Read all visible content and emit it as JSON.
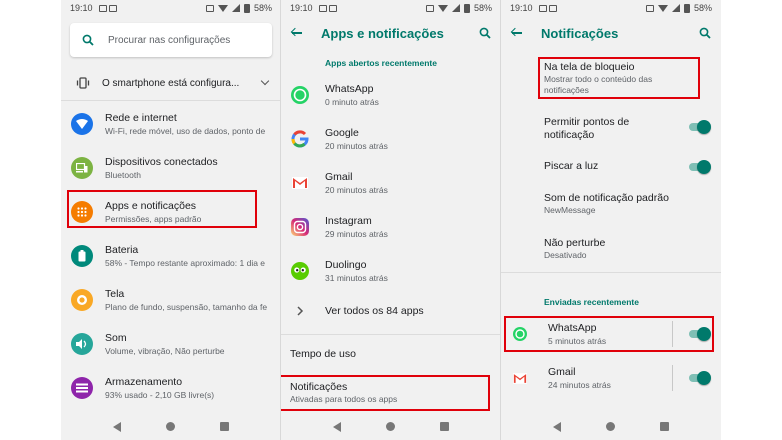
{
  "status": {
    "time": "19:10",
    "battery": "58%"
  },
  "screen1": {
    "search_placeholder": "Procurar nas configurações",
    "suggestion": "O smartphone está configura...",
    "items": [
      {
        "title": "Rede e internet",
        "subtitle": "Wi-Fi, rede móvel, uso de dados, ponto de",
        "color": "#1a73e8",
        "icon": "wifi-icon"
      },
      {
        "title": "Dispositivos conectados",
        "subtitle": "Bluetooth",
        "color": "#7cb342",
        "icon": "devices-icon"
      },
      {
        "title": "Apps e notificações",
        "subtitle": "Permissões, apps padrão",
        "color": "#f57c00",
        "icon": "apps-grid-icon"
      },
      {
        "title": "Bateria",
        "subtitle": "58% - Tempo restante aproximado: 1 dia e",
        "color": "#00897b",
        "icon": "battery-icon"
      },
      {
        "title": "Tela",
        "subtitle": "Plano de fundo, suspensão, tamanho da fe",
        "color": "#f9a825",
        "icon": "brightness-icon"
      },
      {
        "title": "Som",
        "subtitle": "Volume, vibração, Não perturbe",
        "color": "#26a69a",
        "icon": "volume-icon"
      },
      {
        "title": "Armazenamento",
        "subtitle": "93% usado - 2,10 GB livre(s)",
        "color": "#8e24aa",
        "icon": "storage-icon"
      }
    ]
  },
  "screen2": {
    "title": "Apps e notificações",
    "section": "Apps abertos recentemente",
    "apps": [
      {
        "name": "WhatsApp",
        "time": "0 minuto atrás",
        "icon": "whatsapp-icon"
      },
      {
        "name": "Google",
        "time": "20 minutos atrás",
        "icon": "google-icon"
      },
      {
        "name": "Gmail",
        "time": "20 minutos atrás",
        "icon": "gmail-icon"
      },
      {
        "name": "Instagram",
        "time": "29 minutos atrás",
        "icon": "instagram-icon"
      },
      {
        "name": "Duolingo",
        "time": "31 minutos atrás",
        "icon": "duolingo-icon"
      }
    ],
    "see_all": "Ver todos os 84 apps",
    "screen_time": "Tempo de uso",
    "notifications_title": "Notificações",
    "notifications_sub": "Ativadas para todos os apps"
  },
  "screen3": {
    "title": "Notificações",
    "lock_title": "Na tela de bloqueio",
    "lock_sub_1": "Mostrar todo o conteúdo das",
    "lock_sub_2": "notificações",
    "dots_title_1": "Permitir pontos de",
    "dots_title_2": "notificação",
    "blink": "Piscar a luz",
    "sound_title": "Som de notificação padrão",
    "sound_sub": "NewMessage",
    "dnd_title": "Não perturbe",
    "dnd_sub": "Desativado",
    "section": "Enviadas recentemente",
    "recent": [
      {
        "name": "WhatsApp",
        "time": "5 minutos atrás"
      },
      {
        "name": "Gmail",
        "time": "24 minutos atrás"
      }
    ]
  },
  "colors": {
    "accent": "#00796b",
    "highlight": "#e0000a"
  }
}
